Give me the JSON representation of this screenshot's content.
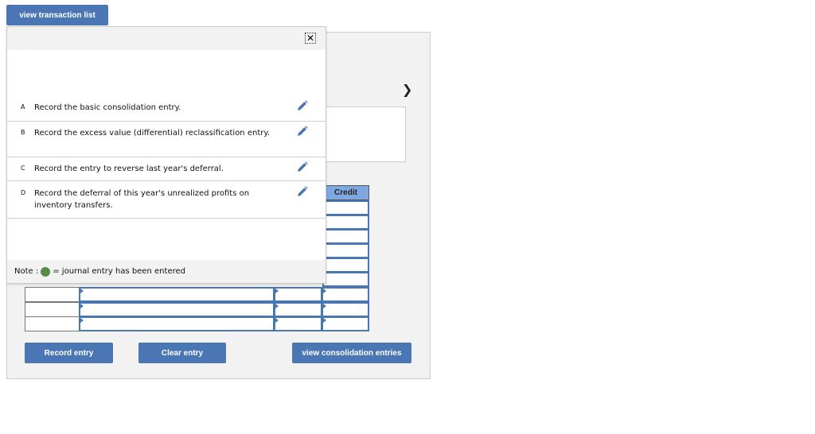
{
  "top_button": "view transaction list",
  "table": {
    "credit_header": "Credit"
  },
  "buttons": {
    "record": "Record entry",
    "clear": "Clear entry",
    "view_consolidation": "view consolidation entries"
  },
  "popup": {
    "close_icon": "close-icon",
    "items": [
      {
        "letter": "A",
        "text": "Record the basic consolidation entry."
      },
      {
        "letter": "B",
        "text": "Record the excess value (differential) reclassification entry."
      },
      {
        "letter": "C",
        "text": "Record the entry to reverse last year's deferral."
      },
      {
        "letter": "D",
        "text": "Record the deferral of this year's unrealized profits on inventory transfers."
      }
    ],
    "note_prefix": "Note :",
    "note_suffix": "= journal entry has been entered"
  },
  "colors": {
    "accent": "#4a76b3",
    "header": "#7ea9e0",
    "entered": "#5a8a4a"
  }
}
